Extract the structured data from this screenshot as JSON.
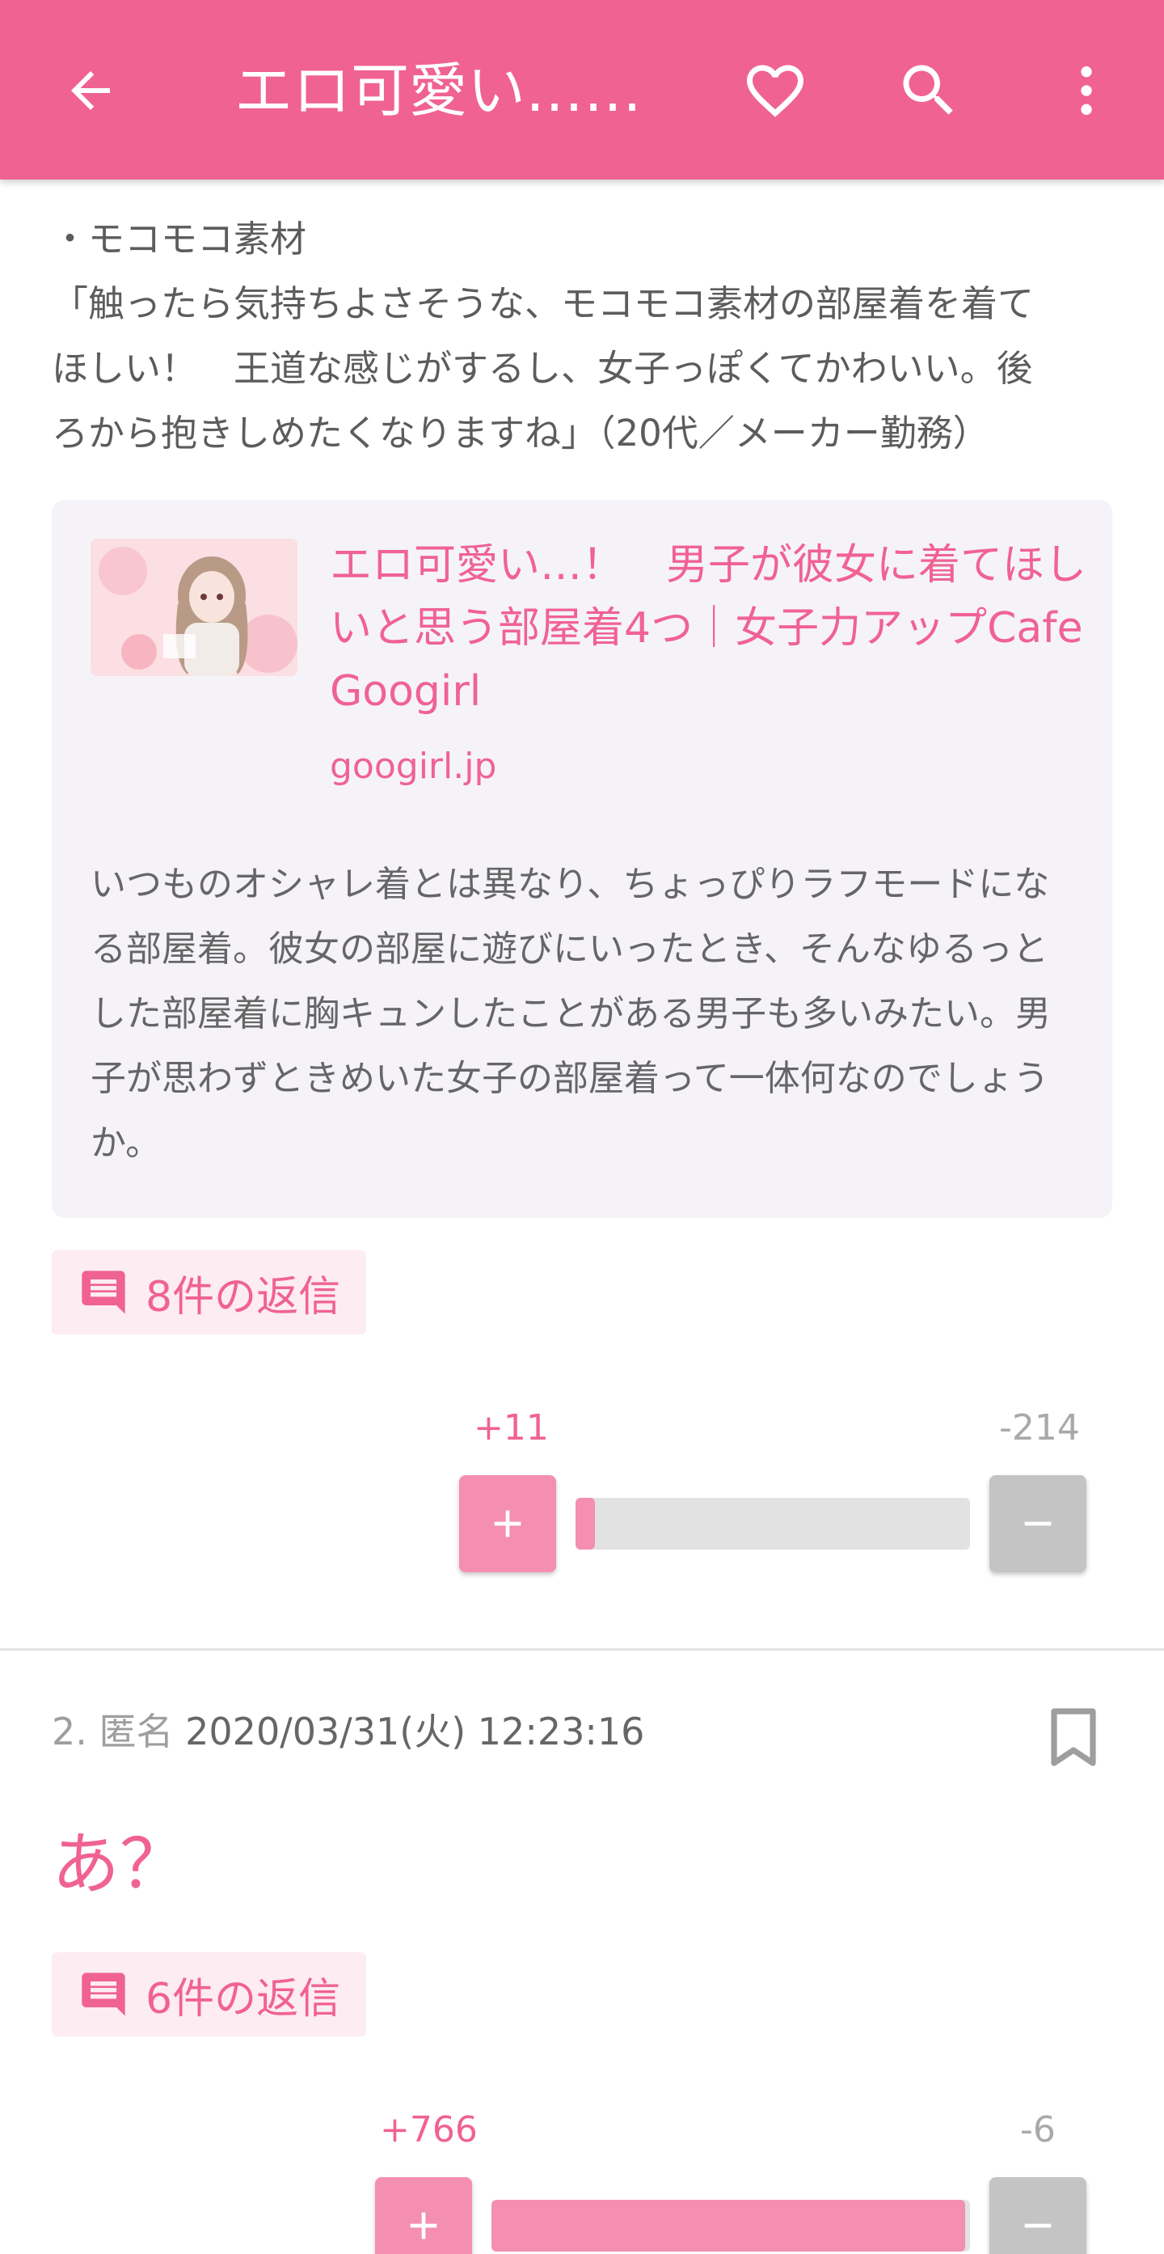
{
  "app_bar": {
    "title": "エロ可愛い……",
    "icons": [
      "arrow-back-icon",
      "heart-outline-icon",
      "search-icon",
      "more-vert-icon"
    ],
    "color": "#f06292"
  },
  "post_1": {
    "lines": [
      "・モコモコ素材",
      "「触ったら気持ちよさそうな、モコモコ素材の部屋着を着て",
      "ほしい！　王道な感じがするし、女子っぽくてかわいい。後",
      "ろから抱きしめたくなりますね」（20代／メーカー勤務）"
    ],
    "link_card": {
      "title": "エロ可愛い…！　男子が彼女に着てほしいと思う部屋着4つ｜女子力アップCafe Googirl",
      "domain": "googirl.jp",
      "description": "いつものオシャレ着とは異なり、ちょっぴりラフモードになる部屋着。彼女の部屋に遊びにいったとき、そんなゆるっとした部屋着に胸キュンしたことがある男子も多いみたい。男子が思わずときめいた女子の部屋着って一体何なのでしょうか。"
    },
    "replies_label": "8件の返信",
    "votes": {
      "plus": "+11",
      "minus": "-214",
      "plus_ratio": 0.05
    }
  },
  "post_2": {
    "number": "2.",
    "author": "匿名",
    "datetime": "2020/03/31(火) 12:23:16",
    "body": "あ？",
    "replies_label": "6件の返信",
    "votes": {
      "plus": "+766",
      "minus": "-6",
      "plus_ratio": 0.99
    }
  }
}
